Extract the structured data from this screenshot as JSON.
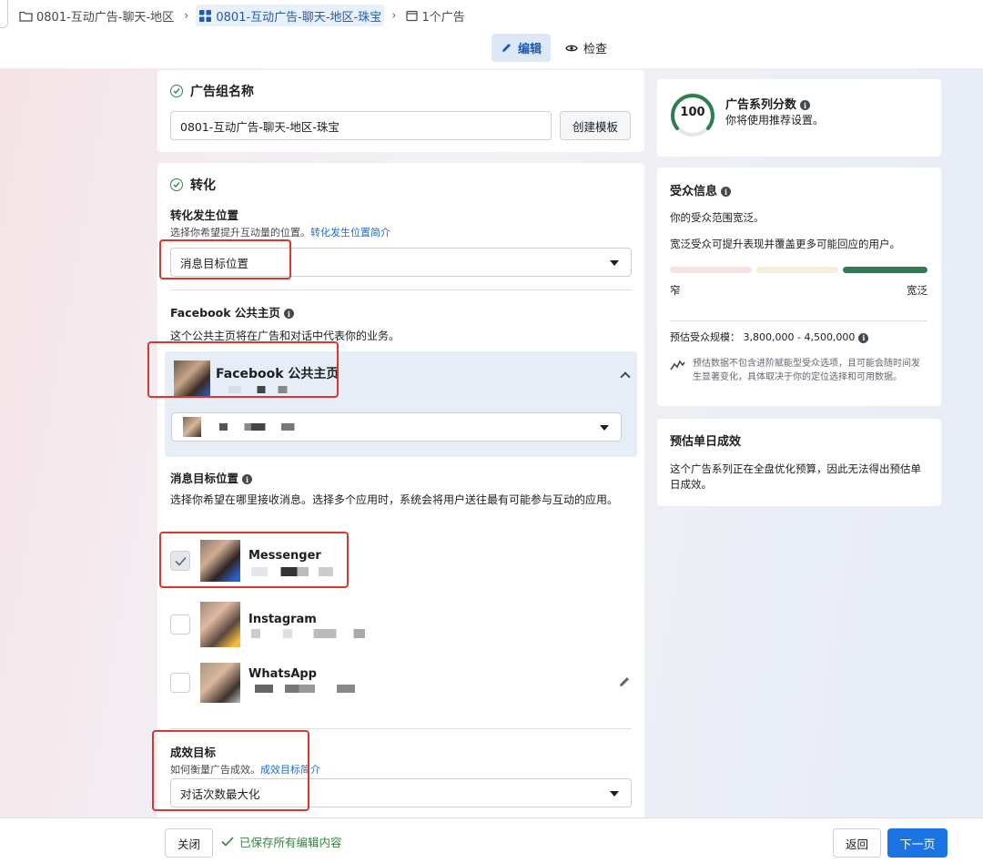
{
  "breadcrumb": {
    "campaign": "0801-互动广告-聊天-地区",
    "ad_set": "0801-互动广告-聊天-地区-珠宝",
    "ads": "1个广告"
  },
  "mode_tabs": {
    "edit": "编辑",
    "review": "检查"
  },
  "ad_set_name": {
    "title": "广告组名称",
    "value": "0801-互动广告-聊天-地区-珠宝",
    "template_button": "创建模板"
  },
  "conversion": {
    "title": "转化",
    "location_label": "转化发生位置",
    "location_help": "选择你希望提升互动量的位置。",
    "location_help_link": "转化发生位置简介",
    "location_value": "消息目标位置"
  },
  "facebook_page": {
    "label": "Facebook 公共主页",
    "help": "这个公共主页将在广告和对话中代表你的业务。",
    "page_name": "Facebook 公共主页"
  },
  "message_destinations": {
    "label": "消息目标位置",
    "help": "选择你希望在哪里接收消息。选择多个应用时，系统会将用户送往最有可能参与互动的应用。",
    "apps": [
      {
        "name": "Messenger",
        "checked": true
      },
      {
        "name": "Instagram",
        "checked": false
      },
      {
        "name": "WhatsApp",
        "checked": false
      }
    ]
  },
  "performance_goal": {
    "label": "成效目标",
    "help": "如何衡量广告成效。",
    "help_link": "成效目标简介",
    "value": "对话次数最大化"
  },
  "campaign_score": {
    "score": "100",
    "title": "广告系列分数",
    "subtitle": "你将使用推荐设置。"
  },
  "audience": {
    "title": "受众信息",
    "line1": "你的受众范围宽泛。",
    "line2": "宽泛受众可提升表现并覆盖更多可能回应的用户。",
    "narrow": "窄",
    "broad": "宽泛",
    "size_label": "预估受众规模：",
    "size_value": "3,800,000 - 4,500,000",
    "note": "预估数据不包含进阶赋能型受众选项，且可能会随时间发生显著变化，具体取决于你的定位选择和可用数据。",
    "meter_level": "broad"
  },
  "daily_results": {
    "title": "预估单日成效",
    "text": "这个广告系列正在全盘优化预算，因此无法得出预估单日成效。"
  },
  "footer": {
    "close": "关闭",
    "saved": "已保存所有编辑内容",
    "back": "返回",
    "next": "下一页"
  },
  "colors": {
    "accent": "#1b74e4",
    "success": "#2e8540",
    "highlight": "#e0352b"
  }
}
